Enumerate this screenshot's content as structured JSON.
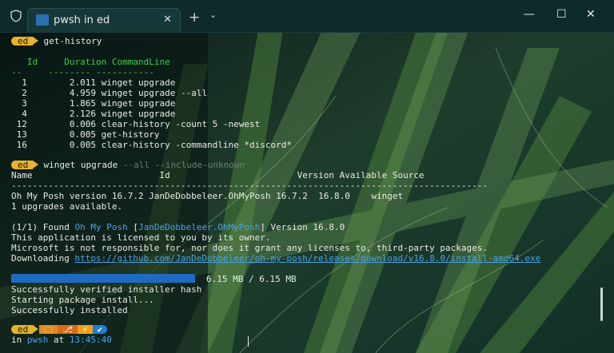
{
  "window": {
    "tab_title": "pwsh in ed",
    "close_tab": "✕",
    "new_tab": "+",
    "tab_dropdown": "⌄",
    "minimize": "—",
    "maximize": "☐",
    "close": "✕"
  },
  "terminal": {
    "prompt1": {
      "badge": "ed",
      "command": "get-history"
    },
    "history_header": {
      "id": "Id",
      "duration": "Duration",
      "cmd": "CommandLine"
    },
    "history_sep": "--     -------- -----------",
    "history": [
      {
        "id": "1",
        "duration": "2.011",
        "cmd": "winget upgrade"
      },
      {
        "id": "2",
        "duration": "4.959",
        "cmd": "winget upgrade --all"
      },
      {
        "id": "3",
        "duration": "1.865",
        "cmd": "winget upgrade"
      },
      {
        "id": "4",
        "duration": "2.126",
        "cmd": "winget upgrade"
      },
      {
        "id": "12",
        "duration": "0.006",
        "cmd": "clear-history -count 5 -newest"
      },
      {
        "id": "13",
        "duration": "0.005",
        "cmd": "get-history"
      },
      {
        "id": "16",
        "duration": "0.005",
        "cmd": "clear-history -commandline *discord*"
      }
    ],
    "prompt2": {
      "badge": "ed",
      "command": "winget upgrade",
      "args": "--all --include-unknown"
    },
    "table_header": "Name                        Id                        Version Available Source",
    "table_sep": "------------------------------------------------------------------------------------------",
    "table_row": "Oh My Posh version 16.7.2 JanDeDobbeleer.OhMyPosh 16.7.2  16.8.0    winget",
    "upgrades_available": "1 upgrades available.",
    "found": {
      "prefix": "(1/1) Found ",
      "name": "Oh My Posh",
      "bracket_open": " [",
      "pkg": "JanDeDobbeleer.OhMyPosh",
      "bracket_close": "]",
      "version": " Version 16.8.0"
    },
    "licensed": "This application is licensed to you by its owner.",
    "ms_disclaimer": "Microsoft is not responsible for, nor does it grant any licenses to, third-party packages.",
    "downloading": "Downloading ",
    "download_url": "https://github.com/JanDeDobbeleer/oh-my-posh/releases/download/v16.8.0/install-amd64.exe",
    "progress_fraction": 1.0,
    "progress_text": "6.15 MB / 6.15 MB",
    "verified": "Successfully verified installer hash",
    "starting": "Starting package install...",
    "installed": "Successfully installed",
    "prompt3": {
      "badge": "ed"
    },
    "status_line": {
      "in": "in ",
      "shell": "pwsh",
      "at": " at ",
      "time": "13:45:40"
    }
  },
  "colors": {
    "badge": "#e9b22a",
    "green": "#3cd04a",
    "blue": "#4aa3e8",
    "progress": "#1f6bc4"
  }
}
